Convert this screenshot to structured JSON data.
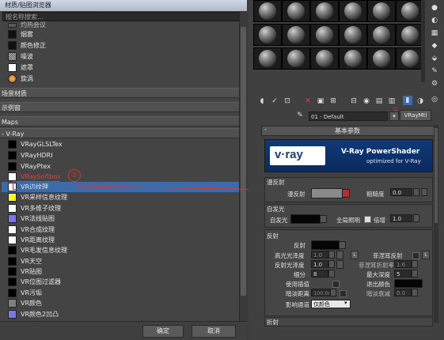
{
  "browser": {
    "title": "材质/贴图浏览器",
    "search_placeholder": "按名称搜索...",
    "top_items": [
      {
        "label": "灼热会议",
        "color": "#5a5a5a"
      },
      {
        "label": "烟雾",
        "color": "#111111"
      },
      {
        "label": "颜色修正",
        "color": "#111111"
      },
      {
        "label": "噪波",
        "color": "#9a9a9a"
      },
      {
        "label": "遮罩",
        "color": "#ffffff"
      },
      {
        "label": "旋涡",
        "color": "#e08a30"
      }
    ],
    "groups": {
      "scene_materials": "场景材质",
      "samples": "示例窗",
      "maps": "Maps",
      "vray": "- V-Ray"
    },
    "vray_items": [
      {
        "label": "VRayGLSLTex",
        "color": "#000000"
      },
      {
        "label": "VRayHDRI",
        "color": "#000000"
      },
      {
        "label": "VRayPtex",
        "color": "#000000"
      },
      {
        "label": "VRaySoftbox",
        "color": "#ffffff"
      },
      {
        "label": "VR边纹理",
        "color": "#ffffff"
      },
      {
        "label": "VR采样信息纹理",
        "color": "#ffff00"
      },
      {
        "label": "VR多维子纹理",
        "color": "#ffffff"
      },
      {
        "label": "VR法线贴图",
        "color": "#7a78e8"
      },
      {
        "label": "VR合成纹理",
        "color": "#ffffff"
      },
      {
        "label": "VR距离纹理",
        "color": "#ffffff"
      },
      {
        "label": "VR毛发信息纹理",
        "color": "#000000"
      },
      {
        "label": "VR天空",
        "color": "#000000"
      },
      {
        "label": "VR贴图",
        "color": "#000000"
      },
      {
        "label": "VR位图过滤器",
        "color": "#000000"
      },
      {
        "label": "VR污垢",
        "color": "#000000"
      },
      {
        "label": "VR颜色",
        "color": "#808080"
      },
      {
        "label": "VR颜色2凹凸",
        "color": "#7a78e8"
      }
    ],
    "ok_label": "确定",
    "cancel_label": "取消"
  },
  "annotations": {
    "circle_left": "①",
    "circle_right": "①"
  },
  "editor": {
    "material_name": "01 - Default",
    "material_type": "VRayMtl",
    "rollout_title": "基本参数",
    "banner_brand": "v·ray",
    "banner_title": "V-Ray PowerShader",
    "banner_subtitle": "optimized for V-Ray",
    "diffuse_section": "漫反射",
    "diffuse_label": "漫反射",
    "roughness_label": "粗糙度",
    "roughness_value": "0.0",
    "selfillum_section": "自发光",
    "selfillum_label": "自发光",
    "gi_label": "全局照明",
    "multiplier_label": "倍增",
    "multiplier_value": "1.0",
    "reflection_section": "反射",
    "reflect_label": "反射",
    "hilight_gloss_label": "高光光泽度",
    "hilight_gloss_value": "1.0",
    "refl_gloss_label": "反射光泽度",
    "refl_gloss_value": "1.0",
    "subdivs_label": "细分",
    "subdivs_value": "8",
    "use_interp_label": "使用插值",
    "dim_distance_label": "暗淡距离",
    "dim_distance_value": "100.0n",
    "affect_channels_label": "影响通道",
    "affect_channels_value": "仅颜色",
    "fresnel_label": "菲涅耳反射",
    "fresnel_ior_label": "菲涅耳折射率",
    "fresnel_ior_value": "1.6",
    "max_depth_label": "最大深度",
    "max_depth_value": "5",
    "exit_color_label": "退出颜色",
    "dim_falloff_label": "暗淡衰减",
    "dim_falloff_value": "0.0",
    "refraction_section": "折射",
    "lock_label": "L"
  }
}
